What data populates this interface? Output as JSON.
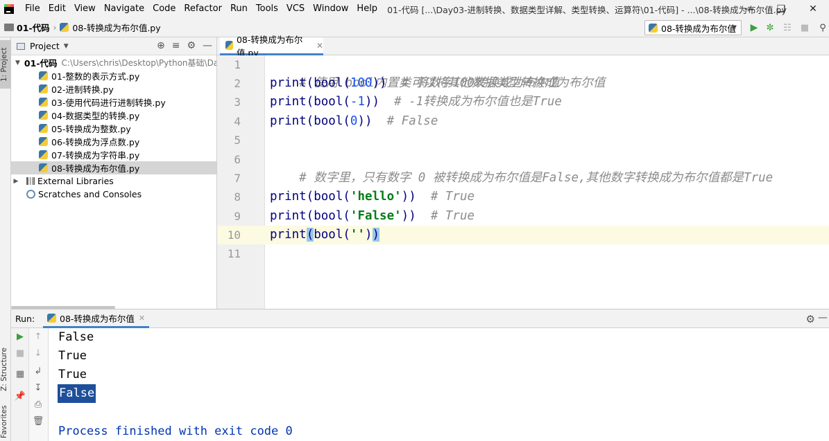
{
  "menubar": {
    "items": [
      "File",
      "Edit",
      "View",
      "Navigate",
      "Code",
      "Refactor",
      "Run",
      "Tools",
      "VCS",
      "Window",
      "Help"
    ],
    "window_title": "01-代码 [...\\Day03-进制转换、数据类型详解、类型转换、运算符\\01-代码] - ...\\08-转换成为布尔值.py"
  },
  "navbar": {
    "project": "01-代码",
    "file": "08-转换成为布尔值.py",
    "run_config": "08-转换成为布尔值"
  },
  "sidebar_tabs": {
    "project": "1: Project",
    "structure": "Z: Structure",
    "favorites": "Favorites"
  },
  "project_panel": {
    "title": "Project",
    "root": {
      "name": "01-代码",
      "path": "C:\\Users\\chris\\Desktop\\Python基础\\Day"
    },
    "files": [
      "01-整数的表示方式.py",
      "02-进制转换.py",
      "03-使用代码进行进制转换.py",
      "04-数据类型的转换.py",
      "05-转换成为整数.py",
      "06-转换成为浮点数.py",
      "07-转换成为字符串.py",
      "08-转换成为布尔值.py"
    ],
    "external_libraries": "External Libraries",
    "scratches": "Scratches and Consoles"
  },
  "editor": {
    "tab": "08-转换成为布尔值.py",
    "line_numbers": [
      "1",
      "2",
      "3",
      "4",
      "5",
      "6",
      "7",
      "8",
      "9",
      "10",
      "11"
    ],
    "lines": {
      "l1_comment": "# 使用 bool内置类可以将其他数据类型转换成为布尔值",
      "l2_code_a": "print(bool(",
      "l2_num": "100",
      "l2_code_b": "))  ",
      "l2_comment": "# 将数字100转换成为布尔值",
      "l3_code_a": "print(bool(",
      "l3_num": "-1",
      "l3_code_b": "))  ",
      "l3_comment": "# -1转换成为布尔值也是True",
      "l4_code_a": "print(bool(",
      "l4_num": "0",
      "l4_code_b": "))  ",
      "l4_comment": "# False",
      "l6_comment": "# 数字里，只有数字 0 被转换成为布尔值是False,其他数字转换成为布尔值都是True",
      "l8_code_a": "print(bool(",
      "l8_str": "'hello'",
      "l8_code_b": "))  ",
      "l8_comment": "# True",
      "l9_code_a": "print(bool(",
      "l9_str": "'False'",
      "l9_code_b": "))  ",
      "l9_comment": "# True",
      "l10_a": "print",
      "l10_b": "(",
      "l10_c": "bool(",
      "l10_str": "''",
      "l10_d": ")",
      "l10_e": ")"
    }
  },
  "run_panel": {
    "label": "Run:",
    "tab": "08-转换成为布尔值",
    "output": [
      "False",
      "True",
      "True",
      "False"
    ],
    "finished": "Process finished with exit code 0"
  },
  "colors": {
    "keyword": "#000080",
    "comment": "#8c8c8c",
    "number": "#1750eb",
    "string": "#067d17",
    "accent": "#4083c9"
  }
}
